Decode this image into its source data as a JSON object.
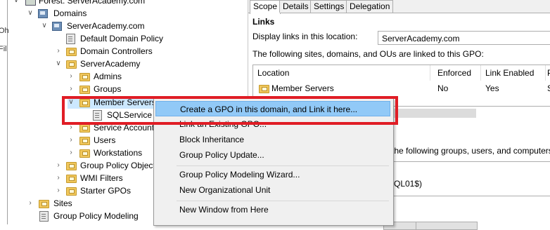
{
  "left_edge_fragments": [
    "Oh",
    "Fil"
  ],
  "tree": {
    "forest": "Forest: ServerAcademy.com",
    "domains": "Domains",
    "domain": "ServerAcademy.com",
    "default_policy": "Default Domain Policy",
    "domain_controllers": "Domain Controllers",
    "serveracademy_ou": "ServerAcademy",
    "admins": "Admins",
    "groups": "Groups",
    "member_servers": "Member Servers",
    "sqlservice": "SQLService L",
    "service_accounts": "Service Account",
    "users": "Users",
    "workstations": "Workstations",
    "gpo_objects": "Group Policy Object",
    "wmi_filters": "WMI Filters",
    "starter_gpos": "Starter GPOs",
    "sites": "Sites",
    "gp_modeling": "Group Policy Modeling"
  },
  "right": {
    "tabs": [
      "Scope",
      "Details",
      "Settings",
      "Delegation"
    ],
    "links_heading": "Links",
    "display_links_label": "Display links in this location:",
    "display_links_value": "ServerAcademy.com",
    "linked_label": "The following sites, domains, and OUs are linked to this GPO:",
    "columns": [
      "Location",
      "Enforced",
      "Link Enabled",
      "P"
    ],
    "rows": [
      {
        "location": "Member Servers",
        "enforced": "No",
        "link_enabled": "Yes",
        "path": "S"
      }
    ],
    "security_label_fragment": "the following groups, users, and computers:",
    "security_value_fragment": "SQL01$)"
  },
  "context_menu": {
    "items": [
      "Create a GPO in this domain, and Link it here...",
      "Link an Existing GPO...",
      "Block Inheritance",
      "Group Policy Update...",
      "Group Policy Modeling Wizard...",
      "New Organizational Unit",
      "New Window from Here"
    ]
  },
  "colors": {
    "highlight_box": "#e01d25",
    "menu_highlight": "#91c9f7",
    "folder": "#f1c75c"
  }
}
